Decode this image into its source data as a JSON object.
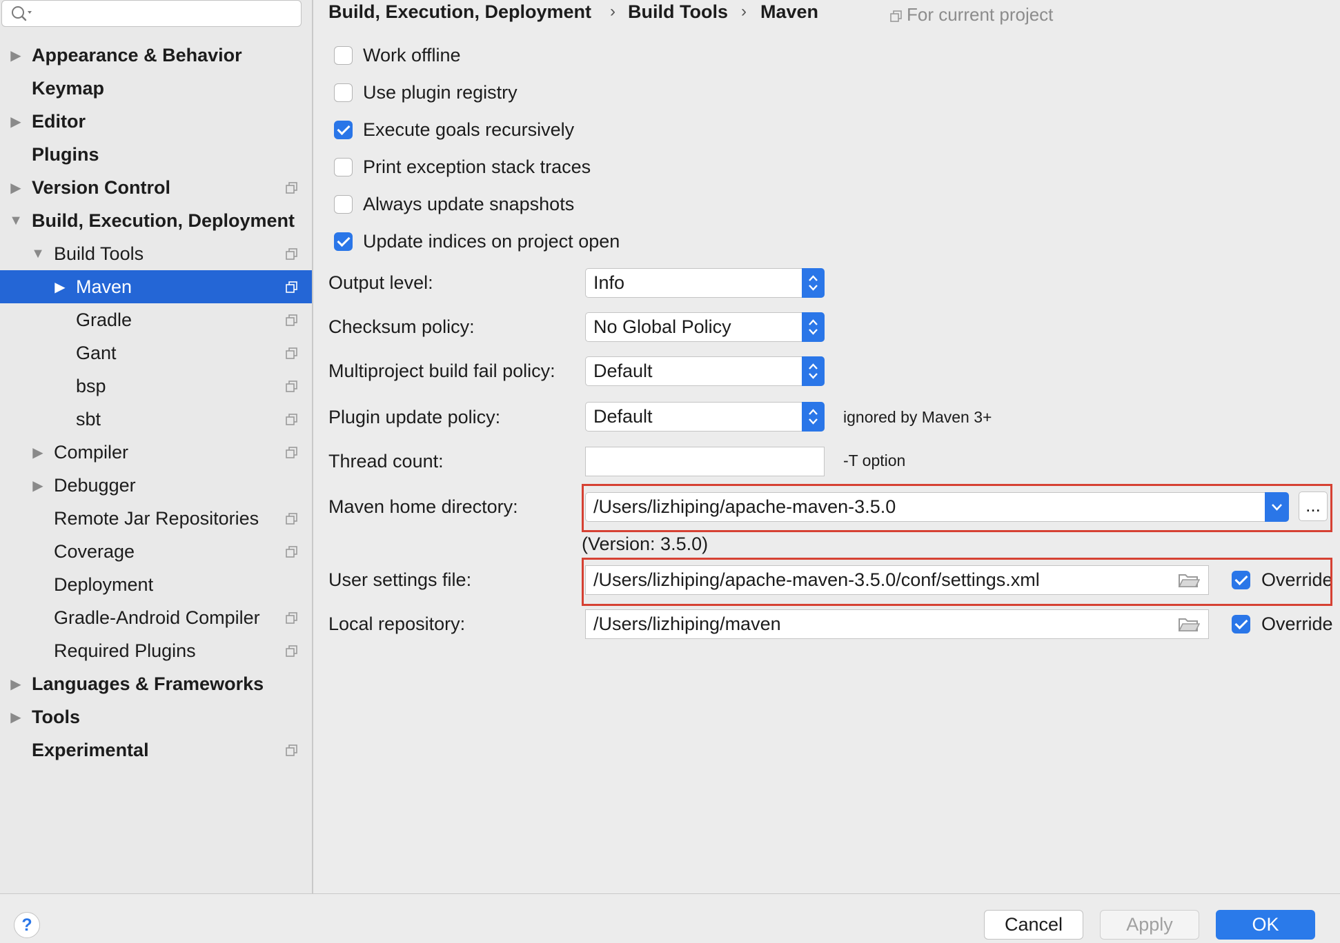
{
  "search": {
    "placeholder": ""
  },
  "sidebar": {
    "items": [
      {
        "label": "Appearance & Behavior",
        "level": 0,
        "bold": true,
        "arrow": "collapsed",
        "shared": false,
        "selected": false
      },
      {
        "label": "Keymap",
        "level": 0,
        "bold": true,
        "arrow": "none",
        "shared": false,
        "selected": false
      },
      {
        "label": "Editor",
        "level": 0,
        "bold": true,
        "arrow": "collapsed",
        "shared": false,
        "selected": false
      },
      {
        "label": "Plugins",
        "level": 0,
        "bold": true,
        "arrow": "none",
        "shared": false,
        "selected": false
      },
      {
        "label": "Version Control",
        "level": 0,
        "bold": true,
        "arrow": "collapsed",
        "shared": true,
        "selected": false
      },
      {
        "label": "Build, Execution, Deployment",
        "level": 0,
        "bold": true,
        "arrow": "expanded",
        "shared": false,
        "selected": false
      },
      {
        "label": "Build Tools",
        "level": 1,
        "bold": false,
        "arrow": "expanded",
        "shared": true,
        "selected": false
      },
      {
        "label": "Maven",
        "level": 2,
        "bold": false,
        "arrow": "collapsed",
        "shared": true,
        "selected": true
      },
      {
        "label": "Gradle",
        "level": 2,
        "bold": false,
        "arrow": "none",
        "shared": true,
        "selected": false
      },
      {
        "label": "Gant",
        "level": 2,
        "bold": false,
        "arrow": "none",
        "shared": true,
        "selected": false
      },
      {
        "label": "bsp",
        "level": 2,
        "bold": false,
        "arrow": "none",
        "shared": true,
        "selected": false
      },
      {
        "label": "sbt",
        "level": 2,
        "bold": false,
        "arrow": "none",
        "shared": true,
        "selected": false
      },
      {
        "label": "Compiler",
        "level": 1,
        "bold": false,
        "arrow": "collapsed",
        "shared": true,
        "selected": false
      },
      {
        "label": "Debugger",
        "level": 1,
        "bold": false,
        "arrow": "collapsed",
        "shared": false,
        "selected": false
      },
      {
        "label": "Remote Jar Repositories",
        "level": 1,
        "bold": false,
        "arrow": "none",
        "shared": true,
        "selected": false
      },
      {
        "label": "Coverage",
        "level": 1,
        "bold": false,
        "arrow": "none",
        "shared": true,
        "selected": false
      },
      {
        "label": "Deployment",
        "level": 1,
        "bold": false,
        "arrow": "none",
        "shared": false,
        "selected": false
      },
      {
        "label": "Gradle-Android Compiler",
        "level": 1,
        "bold": false,
        "arrow": "none",
        "shared": true,
        "selected": false
      },
      {
        "label": "Required Plugins",
        "level": 1,
        "bold": false,
        "arrow": "none",
        "shared": true,
        "selected": false
      },
      {
        "label": "Languages & Frameworks",
        "level": 0,
        "bold": true,
        "arrow": "collapsed",
        "shared": false,
        "selected": false
      },
      {
        "label": "Tools",
        "level": 0,
        "bold": true,
        "arrow": "collapsed",
        "shared": false,
        "selected": false
      },
      {
        "label": "Experimental",
        "level": 0,
        "bold": true,
        "arrow": "none",
        "shared": true,
        "selected": false
      }
    ]
  },
  "breadcrumb": {
    "part1": "Build, Execution, Deployment",
    "part2": "Build Tools",
    "part3": "Maven",
    "separator": "›"
  },
  "scope_note": "For current project",
  "checkboxes": [
    {
      "label": "Work offline",
      "checked": false
    },
    {
      "label": "Use plugin registry",
      "checked": false
    },
    {
      "label": "Execute goals recursively",
      "checked": true
    },
    {
      "label": "Print exception stack traces",
      "checked": false
    },
    {
      "label": "Always update snapshots",
      "checked": false
    },
    {
      "label": "Update indices on project open",
      "checked": true
    }
  ],
  "form": {
    "output_level": {
      "label": "Output level:",
      "value": "Info"
    },
    "checksum_policy": {
      "label": "Checksum policy:",
      "value": "No Global Policy"
    },
    "multiproject_policy": {
      "label": "Multiproject build fail policy:",
      "value": "Default"
    },
    "plugin_update_policy": {
      "label": "Plugin update policy:",
      "value": "Default",
      "hint": "ignored by Maven 3+"
    },
    "thread_count": {
      "label": "Thread count:",
      "value": "",
      "hint": "-T option"
    },
    "maven_home": {
      "label": "Maven home directory:",
      "value": "/Users/lizhiping/apache-maven-3.5.0",
      "browse_label": "...",
      "version": "(Version: 3.5.0)"
    },
    "user_settings": {
      "label": "User settings file:",
      "value": "/Users/lizhiping/apache-maven-3.5.0/conf/settings.xml",
      "override_label": "Override",
      "override_checked": true
    },
    "local_repository": {
      "label": "Local repository:",
      "value": "/Users/lizhiping/maven",
      "override_label": "Override",
      "override_checked": true
    }
  },
  "footer": {
    "help": "?",
    "cancel": "Cancel",
    "apply": "Apply",
    "ok": "OK"
  },
  "colors": {
    "accent": "#2a76e8",
    "selection": "#2466d6",
    "highlight_border": "#d64133"
  }
}
